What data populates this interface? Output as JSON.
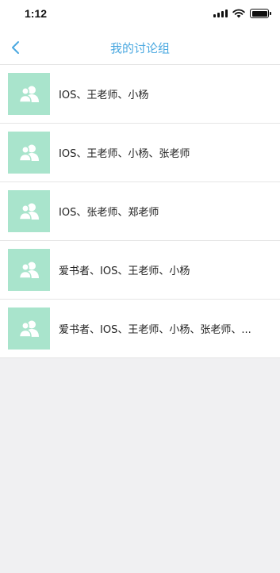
{
  "status_bar": {
    "time": "1:12"
  },
  "nav": {
    "title": "我的讨论组",
    "back_icon": "chevron-left-icon"
  },
  "groups": [
    {
      "name": "IOS、王老师、小杨",
      "icon": "group-avatar-icon"
    },
    {
      "name": "IOS、王老师、小杨、张老师",
      "icon": "group-avatar-icon"
    },
    {
      "name": "IOS、张老师、郑老师",
      "icon": "group-avatar-icon"
    },
    {
      "name": "爱书者、IOS、王老师、小杨",
      "icon": "group-avatar-icon"
    },
    {
      "name": "爱书者、IOS、王老师、小杨、张老师、...",
      "icon": "group-avatar-icon"
    }
  ],
  "colors": {
    "accent": "#4aa8e0",
    "avatar_bg": "#a9e4cc",
    "page_bg": "#f0f0f2"
  }
}
